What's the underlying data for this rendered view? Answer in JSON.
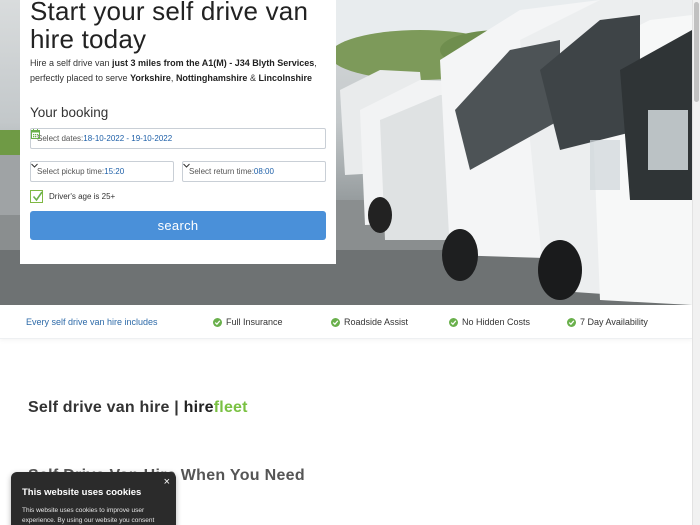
{
  "hero": {
    "title": "Start your self drive van hire today",
    "desc_1": "Hire a self drive van ",
    "desc_bold_1": "just 3 miles from the A1(M) - J34 Blyth Services",
    "desc_2": ", perfectly placed to serve ",
    "desc_bold_2": "Yorkshire",
    "desc_3": ", ",
    "desc_bold_3": "Nottinghamshire",
    "desc_4": " & ",
    "desc_bold_4": "Lincolnshire"
  },
  "booking": {
    "heading": "Your booking",
    "dates_label": "Select dates:",
    "dates_value": "18-10-2022 - 19-10-2022",
    "pickup_label": "Select pickup time:",
    "pickup_value": "15:20",
    "return_label": "Select return time:",
    "return_value": "08:00",
    "age_checked": true,
    "age_label": "Driver's age is 25+",
    "search_label": "search"
  },
  "features": {
    "intro": "Every self drive van hire includes",
    "items": [
      "Full Insurance",
      "Roadside Assist",
      "No Hidden Costs",
      "7 Day Availability"
    ]
  },
  "content": {
    "title_prefix": "Self drive van hire | ",
    "brand_hire": "hire",
    "brand_fleet": "fleet",
    "subtitle": "Self Drive Van Hire When You Need"
  },
  "cookie": {
    "title": "This website uses cookies",
    "text": "This website uses cookies to improve user experience. By using our website you consent",
    "close": "×"
  },
  "colors": {
    "accent_blue": "#4a90d9",
    "brand_green": "#7ac142",
    "link_blue": "#2d6aa8"
  }
}
